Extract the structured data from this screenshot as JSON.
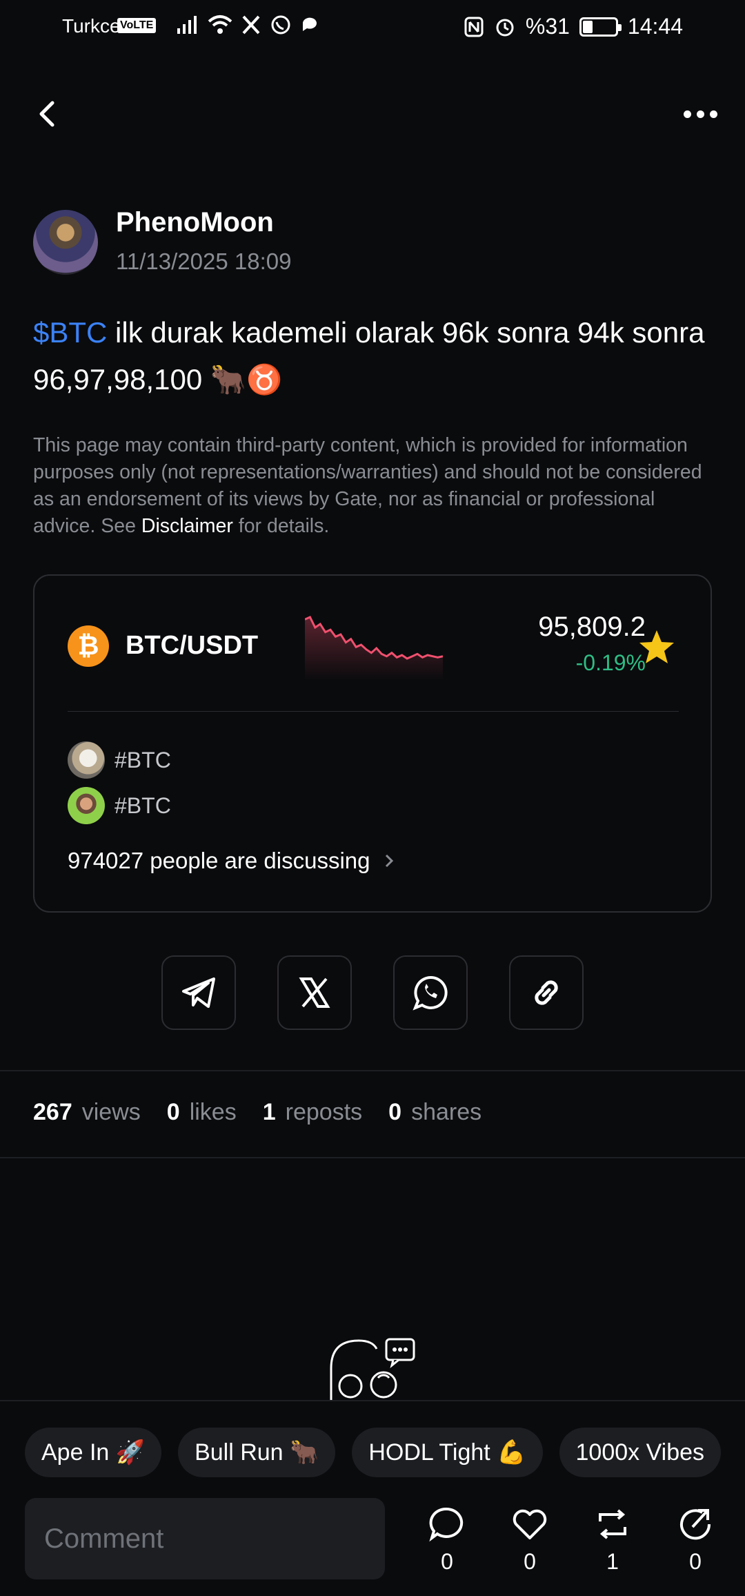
{
  "status_bar": {
    "carrier": "Turkcell",
    "volte": "VoLTE",
    "battery": "%31",
    "battery_level": 0.31,
    "time": "14:44"
  },
  "post": {
    "author": "PhenoMoon",
    "time": "11/13/2025 18:09",
    "cashtag": "$BTC",
    "text": " ilk durak kademeli olarak 96k sonra 94k sonra 96,97,98,100 🐂♉",
    "disclaimer": "This page may contain third-party content, which is provided for information purposes only (not representations/warranties) and should not be considered as an endorsement of its views by Gate, nor as financial or professional advice. See ",
    "disclaimer_link": "Disclaimer",
    "disclaimer_tail": " for details."
  },
  "market": {
    "coin_glyph": "₿",
    "pair": "BTC/USDT",
    "price": "95,809.2",
    "change": "-0.19%",
    "change_color": "#2ebd85",
    "sparkline_color": "#f0506e",
    "sparkline": [
      88,
      92,
      74,
      80,
      66,
      70,
      58,
      62,
      48,
      54,
      40,
      44,
      36,
      30,
      38,
      28,
      24,
      30,
      22,
      26,
      20,
      24,
      28,
      22,
      26,
      24,
      22,
      24
    ],
    "tags": [
      {
        "label": "#BTC"
      },
      {
        "label": "#BTC"
      }
    ],
    "discussing": "974027 people are discussing"
  },
  "stats": [
    {
      "num": "267",
      "label": "views"
    },
    {
      "num": "0",
      "label": "likes"
    },
    {
      "num": "1",
      "label": "reposts"
    },
    {
      "num": "0",
      "label": "shares"
    }
  ],
  "chips": [
    "Ape In 🚀",
    "Bull Run 🐂",
    "HODL Tight 💪",
    "1000x Vibes"
  ],
  "comment_placeholder": "Comment",
  "actions": {
    "comments": "0",
    "likes": "0",
    "reposts": "1",
    "shares": "0"
  }
}
